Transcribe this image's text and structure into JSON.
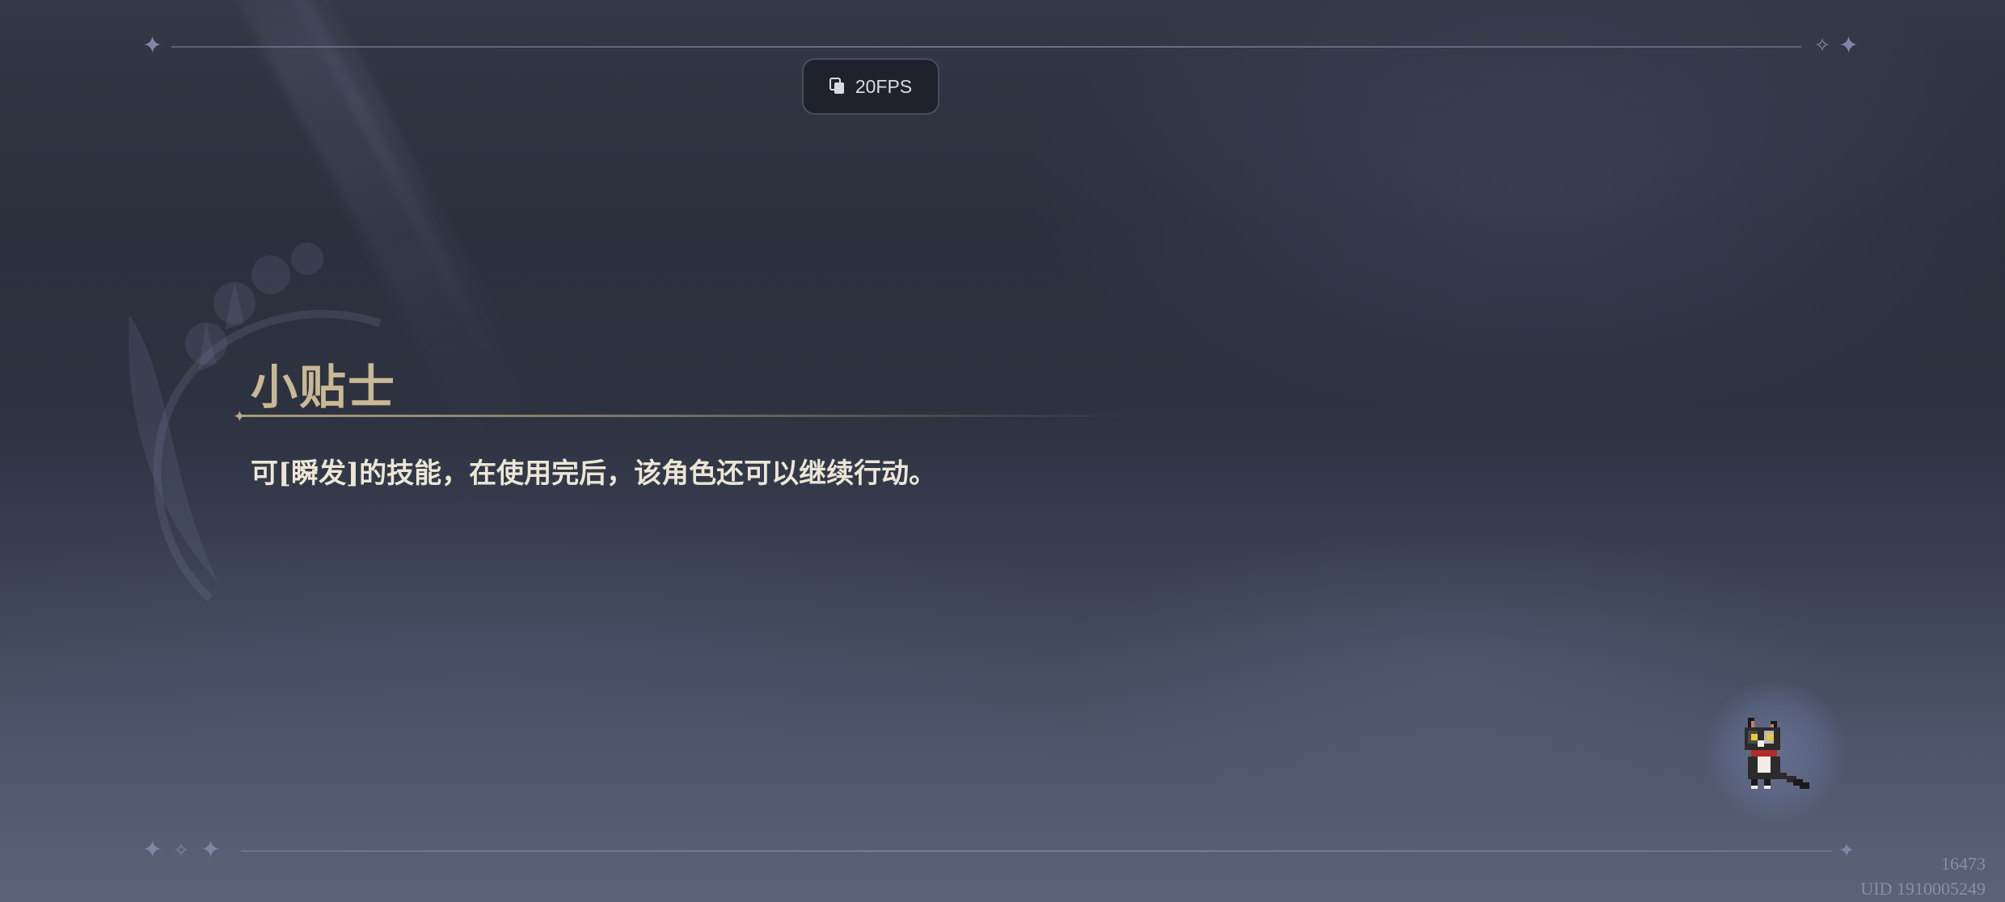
{
  "fps_indicator": {
    "label": "20FPS",
    "icon": "copy-icon"
  },
  "tips": {
    "title": "小贴士",
    "body": "可[瞬发]的技能，在使用完后，该角色还可以继续行动。"
  },
  "footer": {
    "build": "16473",
    "uid": "UID 1910005249"
  },
  "mascot": {
    "icon": "pixel-cat-icon"
  },
  "colors": {
    "title_gold": "#c9b895",
    "body_text": "#ece6d6",
    "frame_line": "#7f87a6"
  }
}
